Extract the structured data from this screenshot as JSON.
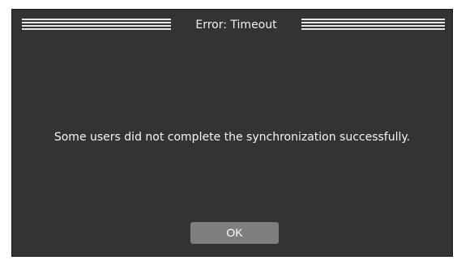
{
  "dialog": {
    "title": "Error: Timeout",
    "message": "Some users did not complete the synchronization successfully.",
    "ok_label": "OK"
  },
  "colors": {
    "background": "#333333",
    "title_stripes": "#e6e6e6",
    "button": "#7e7e7e",
    "text": "#f5f5f5"
  }
}
